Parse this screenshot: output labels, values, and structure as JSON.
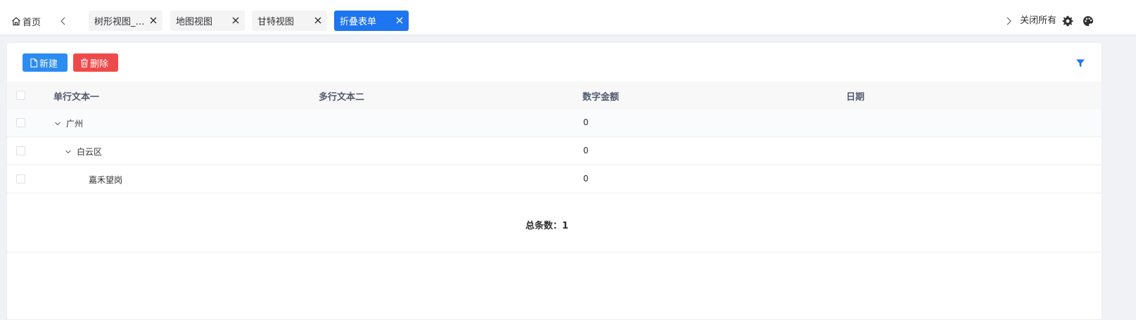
{
  "tabs": {
    "home_label": "首页",
    "items": [
      {
        "label": "树形视图_…",
        "active": false
      },
      {
        "label": "地图视图",
        "active": false
      },
      {
        "label": "甘特视图",
        "active": false
      },
      {
        "label": "折叠表单",
        "active": true
      }
    ],
    "close_all_label": "关闭所有"
  },
  "toolbar": {
    "new_label": "新建",
    "delete_label": "删除"
  },
  "table": {
    "columns": [
      "单行文本一",
      "多行文本二",
      "数字金额",
      "日期"
    ],
    "rows": [
      {
        "name": "广州",
        "level": 0,
        "expanded": true,
        "amount": "0",
        "date": ""
      },
      {
        "name": "白云区",
        "level": 1,
        "expanded": true,
        "amount": "0",
        "date": ""
      },
      {
        "name": "嘉禾望岗",
        "level": 2,
        "expanded": null,
        "amount": "0",
        "date": ""
      }
    ]
  },
  "footer": {
    "total_label": "总条数：",
    "total_value": "1"
  },
  "colors": {
    "primary": "#1e75f0",
    "new_button": "#2d8cf0",
    "delete_button": "#ef4a4a"
  }
}
